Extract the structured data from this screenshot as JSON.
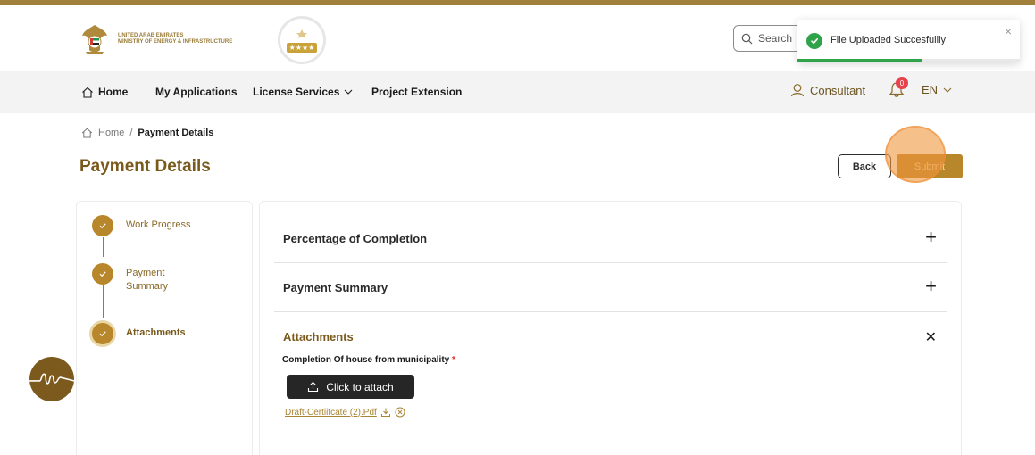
{
  "header": {
    "ministry_line1": "UNITED ARAB EMIRATES",
    "ministry_line2": "MINISTRY OF ENERGY & INFRASTRUCTURE",
    "seal_stars": "★★★★",
    "search_placeholder": "Search"
  },
  "toast": {
    "message": "File Uploaded Succesfullly",
    "close": "×",
    "progress": 0.56
  },
  "nav": {
    "home": "Home",
    "my_applications": "My Applications",
    "license_services": "License Services",
    "project_extension": "Project Extension",
    "user": "Consultant",
    "notification_count": "0",
    "language": "EN"
  },
  "breadcrumb": {
    "home": "Home",
    "separator": "/",
    "current": "Payment Details"
  },
  "page": {
    "title": "Payment Details",
    "back_label": "Back",
    "submit_label": "Submit"
  },
  "steps": [
    {
      "label": "Work Progress"
    },
    {
      "label": "Payment\nSummary"
    },
    {
      "label": "Attachments"
    }
  ],
  "accordion": [
    {
      "title": "Percentage of Completion",
      "icon": "+"
    },
    {
      "title": "Payment Summary",
      "icon": "+"
    },
    {
      "title": "Attachments",
      "icon": "✕"
    }
  ],
  "attachments": {
    "field_label": "Completion Of house from municipality",
    "required_mark": "*",
    "attach_button": "Click to attach",
    "file_name": "Draft-Certiifcate (2).Pdf"
  },
  "colors": {
    "brand_gold": "#b8862b",
    "title_gold": "#7a5a1c",
    "success_green": "#2fa34a"
  }
}
